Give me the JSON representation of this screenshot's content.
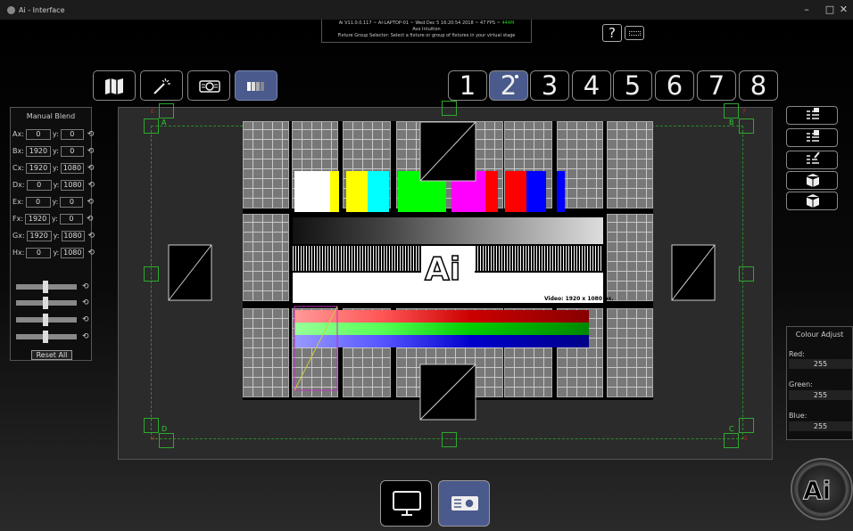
{
  "window": {
    "title": "Ai - Interface",
    "minimize": "–",
    "maximize": "□",
    "close": "✕"
  },
  "info": {
    "line1": "Ai V11.0.0.117 ~ AI-LAPTOP-01 ~ Wed Dec  5 16:20:54 2018 ~ 47 FPS ~ ",
    "mem": "444M",
    "line2": "Avo Intuition",
    "line3": "Fixture Group Selector: Select a fixture or group of fixtures in your virtual stage"
  },
  "help_label": "?",
  "toolbar": {
    "tools": [
      "map-icon",
      "wand-icon",
      "projector-icon",
      "blend-icon"
    ],
    "active_tool": 3
  },
  "pages": {
    "labels": [
      "1",
      "2",
      "3",
      "4",
      "5",
      "6",
      "7",
      "8"
    ],
    "active": 2
  },
  "manual_blend": {
    "title": "Manual Blend",
    "rows": [
      {
        "label": "A",
        "x": "0",
        "y": "0"
      },
      {
        "label": "B",
        "x": "1920",
        "y": "0"
      },
      {
        "label": "C",
        "x": "1920",
        "y": "1080"
      },
      {
        "label": "D",
        "x": "0",
        "y": "1080"
      },
      {
        "label": "E",
        "x": "0",
        "y": "0"
      },
      {
        "label": "F",
        "x": "1920",
        "y": "0"
      },
      {
        "label": "G",
        "x": "1920",
        "y": "1080"
      },
      {
        "label": "H",
        "x": "0",
        "y": "1080"
      }
    ],
    "x_prefix": "x:",
    "y_prefix": "y:",
    "reset_label": "Reset All"
  },
  "stage": {
    "corners": {
      "a": "A",
      "b": "B",
      "c": "C",
      "d": "D"
    },
    "red_corners": {
      "e": "E",
      "f": "F",
      "g": "G",
      "h": "H"
    },
    "video_label": "Video: 1920 x 1080 px."
  },
  "colour_adjust": {
    "title": "Colour Adjust",
    "red_label": "Red:",
    "red": "255",
    "green_label": "Green:",
    "green": "255",
    "blue_label": "Blue:",
    "blue": "255"
  },
  "bottom": {
    "buttons": [
      "monitor-icon",
      "projector-icon"
    ],
    "active": 1
  },
  "logo_text": "Ai",
  "colors": {
    "accent": "#4b5a8c",
    "guide": "#2ea82e",
    "fps": "#22cc22",
    "marker": "#cc2222"
  }
}
